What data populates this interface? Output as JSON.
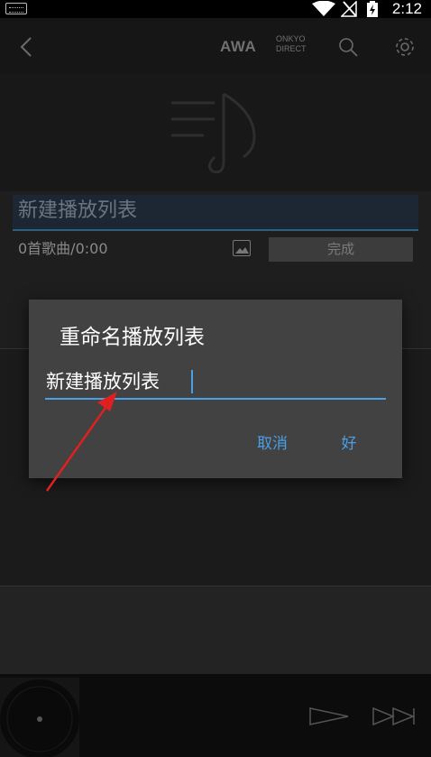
{
  "status_bar": {
    "time": "2:12"
  },
  "header": {
    "brand_awa": "AWA",
    "brand_onkyo_line1": "ONKYO",
    "brand_onkyo_line2": "DIRECT"
  },
  "playlist": {
    "name": "新建播放列表",
    "song_count": "0首歌曲/0:00",
    "done_label": "完成"
  },
  "dialog": {
    "title": "重命名播放列表",
    "input_value": "新建播放列表",
    "cancel_label": "取消",
    "ok_label": "好",
    "accent_color": "#4a9fe6"
  },
  "icons": [
    "keyboard-icon",
    "wifi-icon",
    "signal-icon",
    "battery-icon",
    "back-icon",
    "search-icon",
    "gear-icon",
    "playlist-music-icon",
    "image-icon",
    "play-icon",
    "next-icon",
    "vinyl-icon",
    "red-arrow-annotation"
  ]
}
